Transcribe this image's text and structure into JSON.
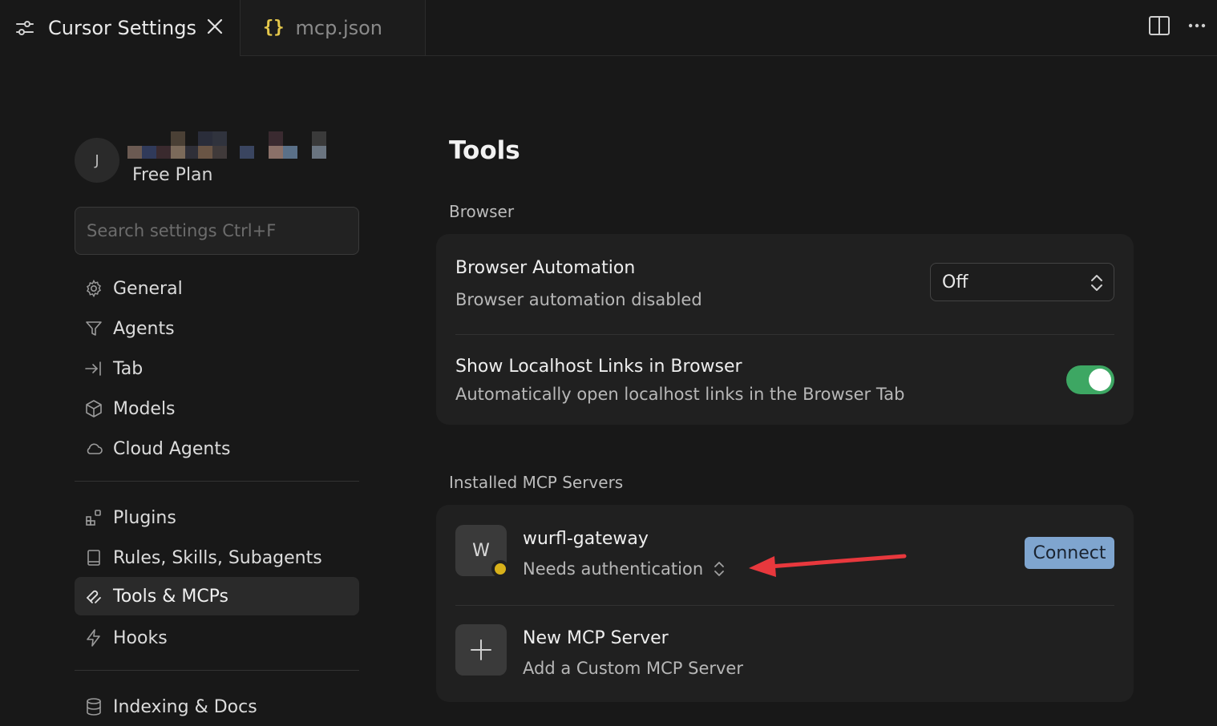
{
  "tabs": [
    {
      "label": "Cursor Settings",
      "icon": "sliders-icon",
      "active": true
    },
    {
      "label": "mcp.json",
      "icon": "braces-icon",
      "active": false
    }
  ],
  "tab_mcp_glyph": "{}",
  "user": {
    "avatar_initial": "J",
    "plan": "Free Plan"
  },
  "search": {
    "placeholder": "Search settings Ctrl+F"
  },
  "nav": {
    "general": "General",
    "agents": "Agents",
    "tab": "Tab",
    "models": "Models",
    "cloud_agents": "Cloud Agents",
    "plugins": "Plugins",
    "rules": "Rules, Skills, Subagents",
    "tools": "Tools & MCPs",
    "hooks": "Hooks",
    "indexing": "Indexing & Docs"
  },
  "page": {
    "title": "Tools"
  },
  "browser": {
    "section": "Browser",
    "automation_title": "Browser Automation",
    "automation_desc": "Browser automation disabled",
    "automation_value": "Off",
    "localhost_title": "Show Localhost Links in Browser",
    "localhost_desc": "Automatically open localhost links in the Browser Tab",
    "localhost_enabled": true
  },
  "mcp": {
    "section": "Installed MCP Servers",
    "server_initial": "W",
    "server_name": "wurfl-gateway",
    "server_status": "Needs authentication",
    "connect_label": "Connect",
    "new_title": "New MCP Server",
    "new_desc": "Add a Custom MCP Server"
  },
  "colors": {
    "toggle_on": "#3da763",
    "connect_bg": "#7fa5cf",
    "status_dot": "#d8b11a",
    "annotation_arrow": "#e8383d"
  }
}
